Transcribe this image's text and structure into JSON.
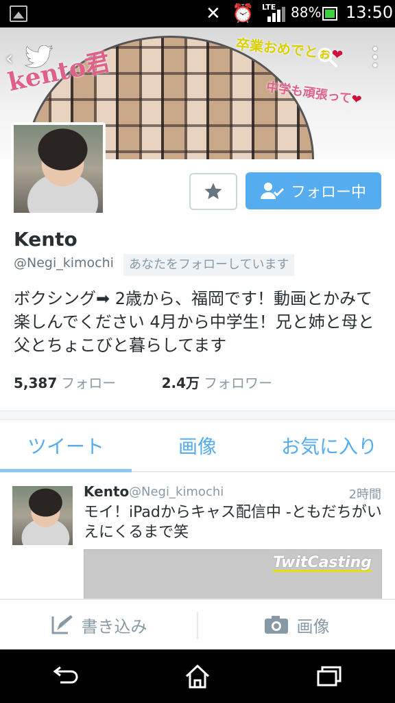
{
  "statusbar": {
    "lte": "LTE",
    "battery_pct": "88%",
    "time": "13:50"
  },
  "banner": {
    "overlay_name": "kento君",
    "overlay_grad": "卒業おめでとぉ",
    "overlay_jhs": "中学も頑張って",
    "heart": "❤"
  },
  "profile": {
    "name": "Kento",
    "handle": "@Negi_kimochi",
    "follows_you": "あなたをフォローしています",
    "bio": "ボクシング➡ 2歳から、福岡です！動画とかみて楽しんでください 4月から中学生！兄と姉と母と父とちょこびと暮らしてます",
    "follow_button": "フォロー中",
    "following_count": "5,387",
    "following_label": "フォロー",
    "followers_count": "2.4万",
    "followers_label": "フォロワー"
  },
  "tabs": [
    {
      "label": "ツイート",
      "active": true
    },
    {
      "label": "画像",
      "active": false
    },
    {
      "label": "お気に入り",
      "active": false
    }
  ],
  "tweet": {
    "name": "Kento",
    "handle": "@Negi_kimochi",
    "time": "2時間",
    "text": "モイ！iPadからキャス配信中 -ともだちがいえにくるまで笑",
    "card_brand": "TwitCasting"
  },
  "bottombar": {
    "compose_label": "書き込み",
    "image_label": "画像"
  },
  "colors": {
    "accent": "#55acee",
    "muted": "#8899a6"
  },
  "icons": [
    "back-arrow-icon",
    "twitter-bird-icon",
    "search-icon",
    "more-vert-icon",
    "star-icon",
    "person-check-icon",
    "compose-icon",
    "camera-icon",
    "nav-back-icon",
    "nav-home-icon",
    "nav-recents-icon"
  ]
}
